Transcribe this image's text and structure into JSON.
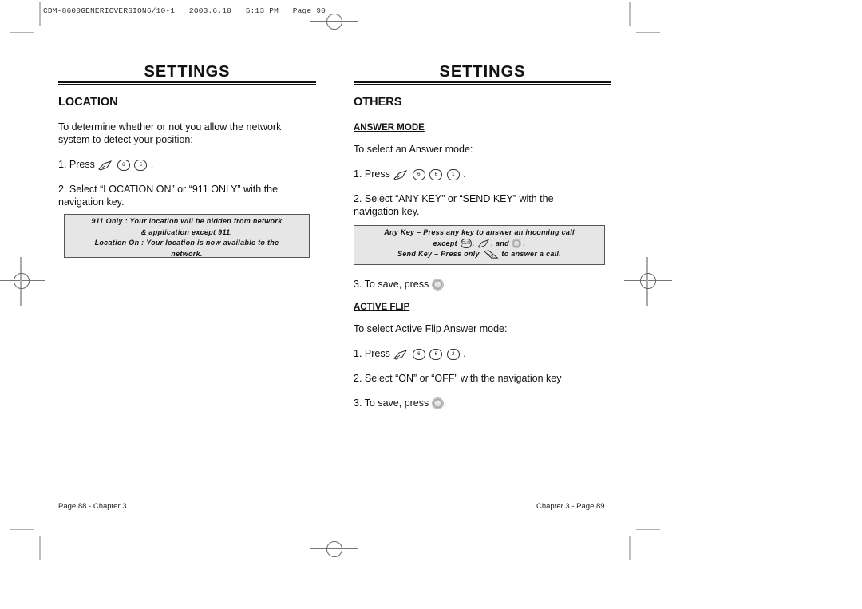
{
  "print_header": {
    "text": "CDM-8600GENERICVERSION6/10-1   2003.6.10   5:13 PM   Page 90"
  },
  "left_page": {
    "section_title": "SETTINGS",
    "heading": "LOCATION",
    "intro": "To determine whether or not you allow the network system to detect your position:",
    "step1_prefix": "1. Press",
    "step1_keys": [
      "menu-key",
      "6mno",
      "5jkl"
    ],
    "step1_key_labels": [
      "6",
      "5"
    ],
    "step1_suffix": ".",
    "step2": "2. Select “LOCATION ON” or “911 ONLY” with the navigation key.",
    "note_lines": [
      "911 Only : Your location will be hidden from network",
      "& application except 911.",
      "Location On : Your location is now available to the",
      "network."
    ],
    "footer": "Page 88 - Chapter 3"
  },
  "right_page": {
    "section_title": "SETTINGS",
    "heading": "OTHERS",
    "answer_mode": {
      "subheading": "ANSWER MODE",
      "intro": "To select an Answer mode:",
      "step1_prefix": "1. Press",
      "step1_key_labels": [
        "6",
        "6",
        "1"
      ],
      "step1_suffix": ".",
      "step2": "2. Select “ANY KEY” or “SEND KEY” with the navigation key.",
      "note_line1": "Any Key – Press any key to answer an incoming call",
      "note_line2_prefix": "except",
      "note_line2_clr": "CLR",
      "note_line2_mid": ",",
      "note_line2_and": ", and",
      "note_line2_suffix": ".",
      "note_line3_prefix": "Send Key – Press only",
      "note_line3_suffix": "to answer a call.",
      "step3_prefix": "3. To save, press",
      "step3_suffix": ".",
      "ok_label": "OK"
    },
    "active_flip": {
      "subheading": "ACTIVE FLIP",
      "intro": "To select Active Flip Answer mode:",
      "step1_prefix": "1. Press",
      "step1_key_labels": [
        "6",
        "6",
        "2"
      ],
      "step1_suffix": ".",
      "step2": "2. Select “ON” or “OFF” with the navigation key",
      "step3_prefix": "3. To save, press",
      "step3_suffix": ".",
      "ok_label": "OK"
    },
    "footer": "Chapter 3 - Page 89"
  }
}
